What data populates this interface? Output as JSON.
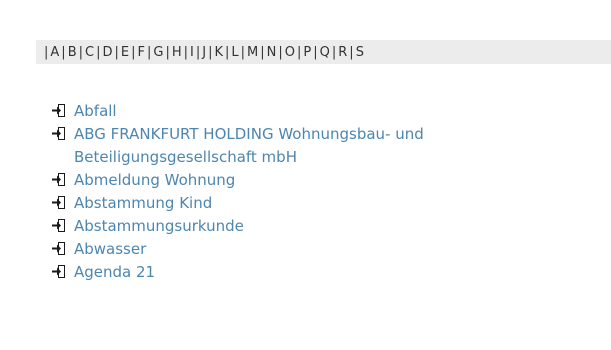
{
  "alphabet": {
    "separator": "|",
    "letters": [
      "A",
      "B",
      "C",
      "D",
      "E",
      "F",
      "G",
      "H",
      "I",
      "J",
      "K",
      "L",
      "M",
      "N",
      "O",
      "P",
      "Q",
      "R",
      "S"
    ]
  },
  "entries": [
    {
      "label": "Abfall",
      "icon": "arrow-right-box-icon"
    },
    {
      "label": "ABG FRANKFURT HOLDING Wohnungsbau- und Beteiligungsgesellschaft mbH",
      "icon": "arrow-right-box-icon"
    },
    {
      "label": "Abmeldung Wohnung",
      "icon": "arrow-right-box-icon"
    },
    {
      "label": "Abstammung Kind",
      "icon": "arrow-right-box-icon"
    },
    {
      "label": "Abstammungsurkunde",
      "icon": "arrow-right-box-icon"
    },
    {
      "label": "Abwasser",
      "icon": "arrow-right-box-icon"
    },
    {
      "label": "Agenda 21",
      "icon": "arrow-right-box-icon"
    }
  ],
  "colors": {
    "link": "#4d86b0",
    "bar_background": "#ececec",
    "bar_text": "#333333"
  }
}
